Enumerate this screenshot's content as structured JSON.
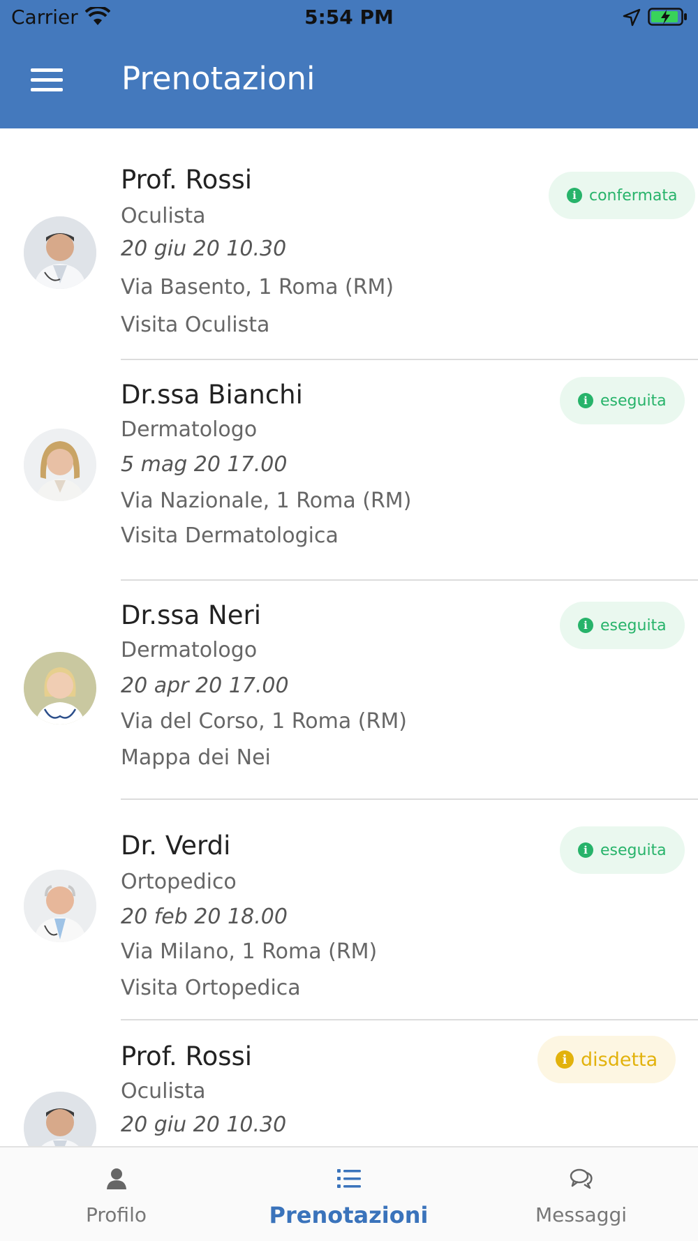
{
  "status_bar": {
    "carrier": "Carrier",
    "time": "5:54 PM"
  },
  "header": {
    "title": "Prenotazioni"
  },
  "appointments": [
    {
      "doctor": "Prof. Rossi",
      "specialty": "Oculista",
      "datetime": "20 giu 20 10.30",
      "address": "Via Basento, 1 Roma (RM)",
      "visit": "Visita Oculista",
      "status": "confermata",
      "status_color": "#27b36a"
    },
    {
      "doctor": "Dr.ssa Bianchi",
      "specialty": "Dermatologo",
      "datetime": "5 mag 20 17.00",
      "address": "Via Nazionale, 1 Roma (RM)",
      "visit": "Visita Dermatologica",
      "status": "eseguita",
      "status_color": "#27b36a"
    },
    {
      "doctor": "Dr.ssa Neri",
      "specialty": "Dermatologo",
      "datetime": "20 apr 20 17.00",
      "address": "Via del Corso, 1 Roma (RM)",
      "visit": "Mappa dei Nei",
      "status": "eseguita",
      "status_color": "#27b36a"
    },
    {
      "doctor": "Dr. Verdi",
      "specialty": "Ortopedico",
      "datetime": "20 feb 20 18.00",
      "address": "Via Milano, 1 Roma (RM)",
      "visit": "Visita Ortopedica",
      "status": "eseguita",
      "status_color": "#27b36a"
    },
    {
      "doctor": "Prof. Rossi",
      "specialty": "Oculista",
      "datetime": "20 giu 20 10.30",
      "status": "disdetta",
      "status_color": "#e2b20c"
    }
  ],
  "tabs": [
    {
      "label": "Profilo",
      "icon": "person-icon"
    },
    {
      "label": "Prenotazioni",
      "icon": "list-icon",
      "active": true
    },
    {
      "label": "Messaggi",
      "icon": "chat-bubbles-icon"
    }
  ],
  "colors": {
    "primary": "#4479bd",
    "active_tab": "#3a73bb",
    "status_green": "#27b36a",
    "status_yellow": "#e2b20c"
  }
}
